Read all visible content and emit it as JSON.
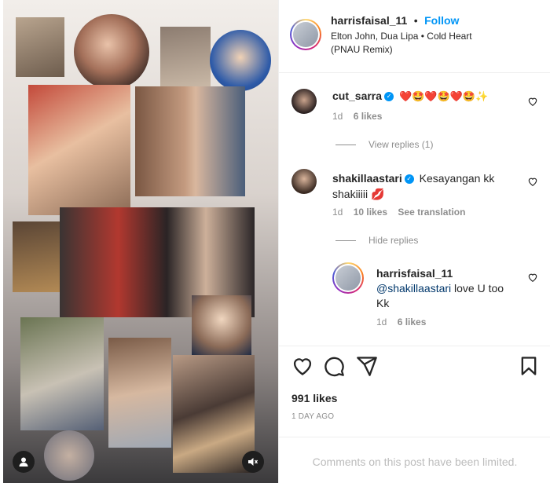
{
  "post": {
    "author": "harrisfaisal_11",
    "separator": "•",
    "follow_label": "Follow",
    "audio": "Elton John, Dua Lipa • Cold Heart (PNAU Remix)",
    "likes": "991 likes",
    "date": "1 DAY AGO",
    "limited_notice": "Comments on this post have been limited."
  },
  "comments": [
    {
      "username": "cut_sarra",
      "text": "❤️🤩❤️🤩❤️🤩✨",
      "age": "1d",
      "likes": "6 likes",
      "view_replies": "View replies (1)"
    },
    {
      "username": "shakillaastari",
      "text": "Kesayangan kk shakiiiii 💋",
      "age": "1d",
      "likes": "10 likes",
      "translate": "See translation",
      "hide_replies": "Hide replies",
      "reply": {
        "username": "harrisfaisal_11",
        "mention": "@shakillaastari",
        "text": " love U too Kk",
        "age": "1d",
        "likes": "6 likes"
      }
    }
  ],
  "icons": {
    "like": "heart-icon",
    "comment": "comment-icon",
    "share": "share-icon",
    "save": "bookmark-icon",
    "verified": "verified-badge-icon",
    "user_tag": "user-icon",
    "mute": "speaker-muted-icon"
  },
  "colors": {
    "accent": "#0095f6",
    "text": "#262626",
    "muted": "#8e8e8e"
  }
}
